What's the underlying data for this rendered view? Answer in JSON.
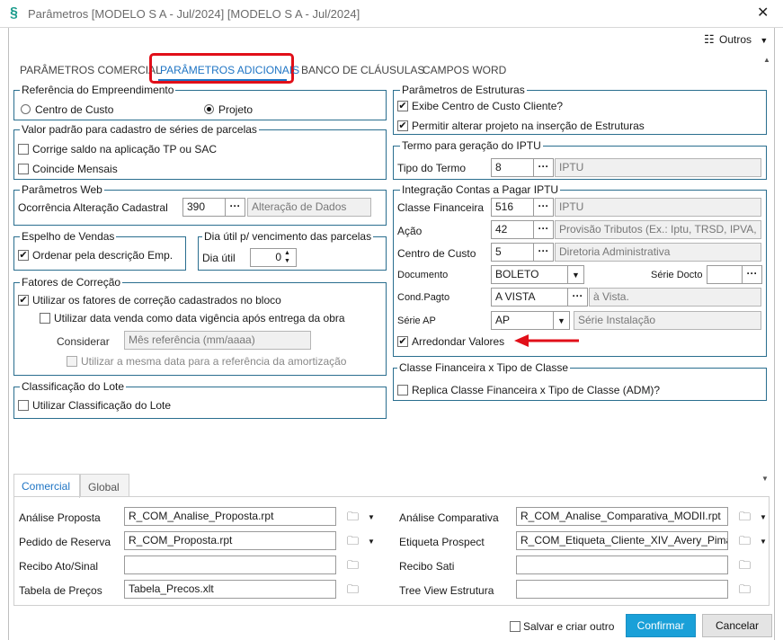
{
  "window": {
    "title": "Parâmetros [MODELO S A - Jul/2024]  [MODELO S A - Jul/2024]"
  },
  "toolbar": {
    "outros": "Outros"
  },
  "tabs": [
    "PARÂMETROS COMERCIAL",
    "PARÂMETROS ADICIONAIS",
    "BANCO DE CLÁUSULAS",
    "CAMPOS WORD"
  ],
  "ref": {
    "legend": "Referência do Empreendimento",
    "opt1": "Centro de Custo",
    "opt2": "Projeto"
  },
  "valor": {
    "legend": "Valor padrão para cadastro de séries de parcelas",
    "c1": "Corrige saldo na aplicação TP ou SAC",
    "c2": "Coincide Mensais"
  },
  "web": {
    "legend": "Parâmetros Web",
    "label": "Ocorrência Alteração Cadastral",
    "code": "390",
    "desc": "Alteração de Dados"
  },
  "espelho": {
    "legend": "Espelho de Vendas",
    "c1": "Ordenar pela descrição Emp."
  },
  "diautil": {
    "legend": "Dia útil p/ vencimento das parcelas",
    "label": "Dia útil",
    "value": "0"
  },
  "fatores": {
    "legend": "Fatores de Correção",
    "c1": "Utilizar os fatores de correção cadastrados no bloco",
    "c2": "Utilizar data venda como data vigência após entrega da obra",
    "considerar": "Considerar",
    "placeholder": "Mês referência (mm/aaaa)",
    "c3": "Utilizar a mesma data para a referência da amortização"
  },
  "lote": {
    "legend": "Classificação do Lote",
    "c1": "Utilizar Classificação do Lote"
  },
  "estruturas": {
    "legend": "Parâmetros de Estruturas",
    "c1": "Exibe Centro de Custo Cliente?",
    "c2": "Permitir alterar projeto na inserção de Estruturas"
  },
  "iptu": {
    "legend": "Termo para geração do IPTU",
    "label": "Tipo do Termo",
    "code": "8",
    "desc": "IPTU"
  },
  "integracao": {
    "legend": "Integração Contas a Pagar IPTU",
    "classe_lbl": "Classe Financeira",
    "classe_code": "516",
    "classe_desc": "IPTU",
    "acao_lbl": "Ação",
    "acao_code": "42",
    "acao_desc": "Provisão Tributos (Ex.: Iptu, TRSD, IPVA,",
    "cc_lbl": "Centro de Custo",
    "cc_code": "5",
    "cc_desc": "Diretoria Administrativa",
    "doc_lbl": "Documento",
    "doc_val": "BOLETO",
    "serie_doc_lbl": "Série Docto",
    "cond_lbl": "Cond.Pagto",
    "cond_val": "A VISTA",
    "cond_desc": "à Vista.",
    "serie_ap_lbl": "Série AP",
    "serie_ap_val": "AP",
    "serie_ap_desc": "Série Instalação",
    "arred": "Arredondar Valores"
  },
  "classe_tipo": {
    "legend": "Classe Financeira x Tipo de Classe",
    "c1": "Replica Classe Financeira x Tipo de Classe (ADM)?"
  },
  "bottom_tabs": [
    "Comercial",
    "Global"
  ],
  "reports": {
    "analise_proposta_lbl": "Análise Proposta",
    "analise_proposta_val": "R_COM_Analise_Proposta.rpt",
    "pedido_lbl": "Pedido de Reserva",
    "pedido_val": "R_COM_Proposta.rpt",
    "recibo_lbl": "Recibo Ato/Sinal",
    "recibo_val": "",
    "tabela_lbl": "Tabela de Preços",
    "tabela_val": "Tabela_Precos.xlt",
    "comparativa_lbl": "Análise Comparativa",
    "comparativa_val": "R_COM_Analise_Comparativa_MODII.rpt",
    "etiqueta_lbl": "Etiqueta Prospect",
    "etiqueta_val": "R_COM_Etiqueta_Cliente_XIV_Avery_Pimaco",
    "sati_lbl": "Recibo Sati",
    "sati_val": "",
    "tree_lbl": "Tree View Estrutura",
    "tree_val": ""
  },
  "footer": {
    "salvar": "Salvar e criar outro",
    "confirmar": "Confirmar",
    "cancelar": "Cancelar"
  },
  "colors": {
    "accent": "#1e74c4",
    "highlight": "#e10f19",
    "confirm": "#1aa0d8",
    "border": "#2a6e8f"
  }
}
